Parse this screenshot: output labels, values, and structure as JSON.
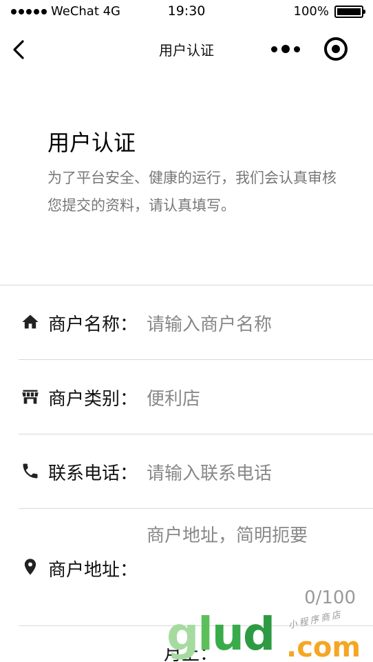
{
  "status_bar": {
    "carrier": "WeChat 4G",
    "time": "19:30",
    "battery_text": "100%",
    "battery_level": 1.0
  },
  "nav": {
    "title": "用户认证",
    "back_icon": "chevron-left-icon",
    "more_icon": "more-dots-icon",
    "close_icon": "target-close-icon"
  },
  "intro": {
    "heading": "用户认证",
    "description": "为了平台安全、健康的运行，我们会认真审核您提交的资料，请认真填写。"
  },
  "form": {
    "merchant_name": {
      "label": "商户名称：",
      "placeholder": "请输入商户名称",
      "icon": "home-icon"
    },
    "merchant_type": {
      "label": "商户类别：",
      "value": "便利店",
      "icon": "store-icon"
    },
    "contact_phone": {
      "label": "联系电话：",
      "placeholder": "请输入联系电话",
      "icon": "phone-icon"
    },
    "merchant_address": {
      "label": "商户地址：",
      "placeholder": "商户地址，简明扼要",
      "counter": "0/100",
      "icon": "location-pin-icon"
    },
    "next_row_partial": "月上："
  },
  "watermark": {
    "brand": "glud",
    "suffix": ".com",
    "tagline": "小程序商店"
  },
  "colors": {
    "label": "#111111",
    "placeholder": "#888888",
    "divider": "#d8d8d8",
    "watermark_green": "#5cc05a",
    "watermark_orange": "#f5a623"
  }
}
